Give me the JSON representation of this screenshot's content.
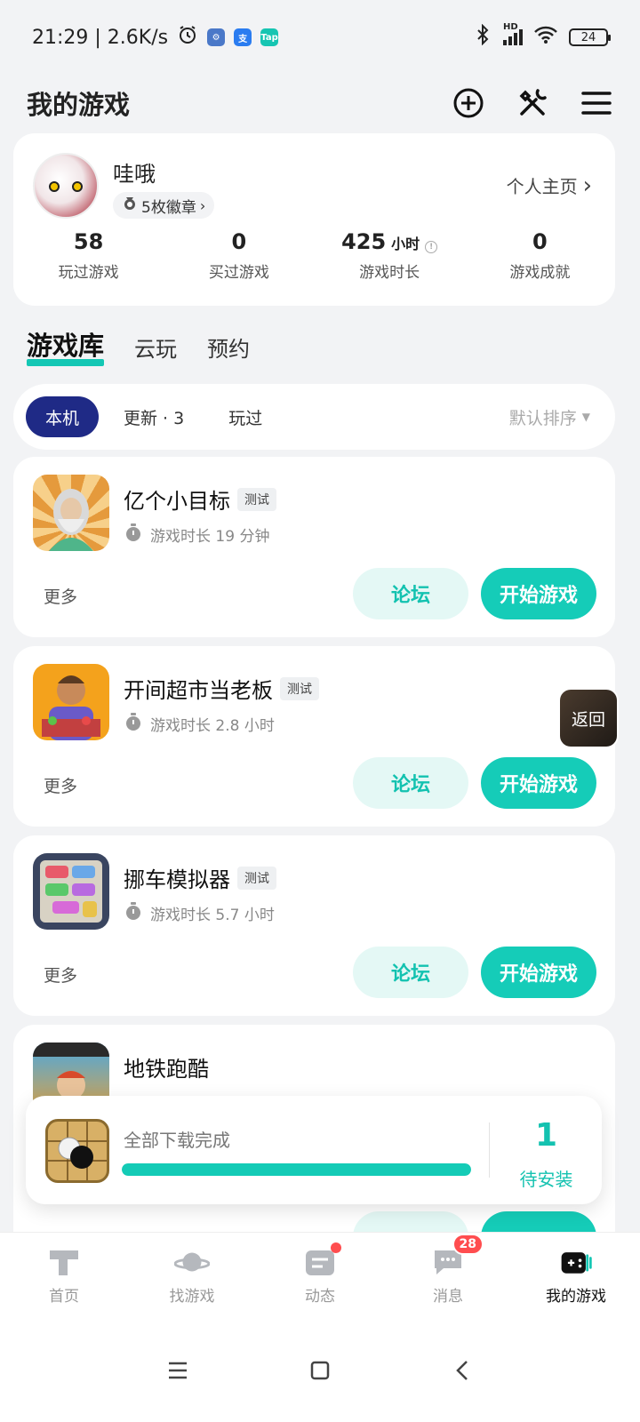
{
  "status_bar": {
    "time_speed": "21:29 | 2.6K/s",
    "network": "HD",
    "battery": "24"
  },
  "header": {
    "title": "我的游戏",
    "icons": [
      "add-circle-icon",
      "tools-icon",
      "menu-icon"
    ]
  },
  "profile": {
    "username": "哇哦",
    "badges": "5枚徽章",
    "homepage": "个人主页",
    "stats": [
      {
        "value": "58",
        "unit": "",
        "label": "玩过游戏"
      },
      {
        "value": "0",
        "unit": "",
        "label": "买过游戏"
      },
      {
        "value": "425",
        "unit": "小时",
        "label": "游戏时长"
      },
      {
        "value": "0",
        "unit": "",
        "label": "游戏成就"
      }
    ]
  },
  "library_tabs": [
    "游戏库",
    "云玩",
    "预约"
  ],
  "filters": {
    "chips": [
      "本机",
      "更新 · 3",
      "玩过"
    ],
    "sort": "默认排序"
  },
  "games": [
    {
      "name": "亿个小目标",
      "tag": "测试",
      "playtime": "游戏时长 19 分钟",
      "more": "更多",
      "forum": "论坛",
      "play": "开始游戏"
    },
    {
      "name": "开间超市当老板",
      "tag": "测试",
      "playtime": "游戏时长 2.8 小时",
      "more": "更多",
      "forum": "论坛",
      "play": "开始游戏"
    },
    {
      "name": "挪车模拟器",
      "tag": "测试",
      "playtime": "游戏时长 5.7 小时",
      "more": "更多",
      "forum": "论坛",
      "play": "开始游戏"
    },
    {
      "name": "地铁跑酷",
      "tag": "",
      "playtime": "",
      "more": "",
      "forum": "",
      "play": ""
    }
  ],
  "back_button": "返回",
  "download": {
    "status": "全部下载完成",
    "progress": 1.0,
    "pending_count": "1",
    "pending_label": "待安装"
  },
  "bottom_nav": [
    {
      "label": "首页",
      "icon": "home-icon",
      "badge": ""
    },
    {
      "label": "找游戏",
      "icon": "planet-icon",
      "badge": ""
    },
    {
      "label": "动态",
      "icon": "feed-icon",
      "badge": "dot"
    },
    {
      "label": "消息",
      "icon": "message-icon",
      "badge": "28"
    },
    {
      "label": "我的游戏",
      "icon": "gamepad-icon",
      "badge": ""
    }
  ],
  "colors": {
    "accent": "#15ccb8",
    "navy_chip": "#1f2a86",
    "badge_red": "#ff4d4f"
  }
}
